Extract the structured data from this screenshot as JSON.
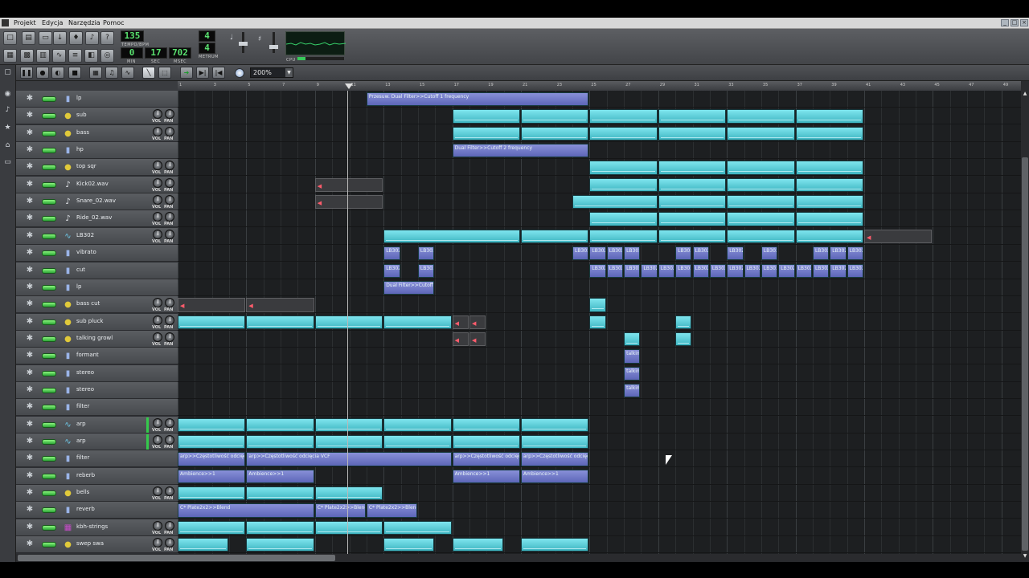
{
  "menu": [
    "Projekt",
    "Edycja",
    "Narzędzia",
    "Pomoc"
  ],
  "transport": {
    "tempo": "135",
    "tempo_label": "TEMPO/BPM",
    "min": "0",
    "sec": "17",
    "msec": "702",
    "min_label": "MIN",
    "sec_label": "SEC",
    "msec_label": "MSEC",
    "meter_num": "4",
    "meter_den": "4",
    "meter_label": "METRUM",
    "cpu_label": "CPU"
  },
  "song_toolbar": {
    "zoom": "200%"
  },
  "knob_labels": {
    "vol": "VOL",
    "pan": "PAN"
  },
  "ruler_ticks": [
    "1",
    "3",
    "5",
    "7",
    "9",
    "11",
    "13",
    "15",
    "17",
    "19",
    "21",
    "23",
    "25",
    "27",
    "29",
    "31",
    "33",
    "35",
    "37",
    "39",
    "41",
    "43",
    "45",
    "47",
    "49"
  ],
  "colors": {
    "pattern": "#5fd0db",
    "automation": "#7a82cf",
    "track_bg": "#505357",
    "mute_led": "#53d44f"
  },
  "timeline": {
    "playhead_bar": 11
  },
  "tracks": [
    {
      "name": "lp",
      "type": "automation",
      "knobs": false,
      "clips": [
        {
          "kind": "auto",
          "start": 12,
          "len": 13,
          "label": "Przesuw. Dual Filter>>Cutoff 1 frequency"
        }
      ]
    },
    {
      "name": "sub",
      "type": "instrument",
      "knobs": true,
      "clips": [
        {
          "kind": "pat",
          "start": 17,
          "len": 4
        },
        {
          "kind": "pat",
          "start": 21,
          "len": 4
        },
        {
          "kind": "pat",
          "start": 25,
          "len": 4
        },
        {
          "kind": "pat",
          "start": 29,
          "len": 4
        },
        {
          "kind": "pat",
          "start": 33,
          "len": 4
        },
        {
          "kind": "pat",
          "start": 37,
          "len": 4
        }
      ]
    },
    {
      "name": "bass",
      "type": "instrument",
      "knobs": true,
      "clips": [
        {
          "kind": "pat",
          "start": 17,
          "len": 4
        },
        {
          "kind": "pat",
          "start": 21,
          "len": 4
        },
        {
          "kind": "pat",
          "start": 25,
          "len": 4
        },
        {
          "kind": "pat",
          "start": 29,
          "len": 4
        },
        {
          "kind": "pat",
          "start": 33,
          "len": 4
        },
        {
          "kind": "pat",
          "start": 37,
          "len": 4
        }
      ]
    },
    {
      "name": "hp",
      "type": "automation",
      "knobs": false,
      "clips": [
        {
          "kind": "auto",
          "start": 17,
          "len": 8,
          "label": "Dual Filter>>Cutoff 2 frequency"
        }
      ]
    },
    {
      "name": "top sqr",
      "type": "instrument",
      "knobs": true,
      "clips": [
        {
          "kind": "pat",
          "start": 25,
          "len": 4
        },
        {
          "kind": "pat",
          "start": 29,
          "len": 4
        },
        {
          "kind": "pat",
          "start": 33,
          "len": 4
        },
        {
          "kind": "pat",
          "start": 37,
          "len": 4
        }
      ]
    },
    {
      "name": "Kick02.wav",
      "type": "sample",
      "knobs": true,
      "clips": [
        {
          "kind": "smp",
          "start": 9,
          "len": 4
        },
        {
          "kind": "pat",
          "start": 25,
          "len": 4
        },
        {
          "kind": "pat",
          "start": 29,
          "len": 4
        },
        {
          "kind": "pat",
          "start": 33,
          "len": 4
        },
        {
          "kind": "pat",
          "start": 37,
          "len": 4
        }
      ]
    },
    {
      "name": "Snare_02.wav",
      "type": "sample",
      "knobs": true,
      "clips": [
        {
          "kind": "smp",
          "start": 9,
          "len": 4
        },
        {
          "kind": "pat",
          "start": 24,
          "len": 5
        },
        {
          "kind": "pat",
          "start": 29,
          "len": 4
        },
        {
          "kind": "pat",
          "start": 33,
          "len": 4
        },
        {
          "kind": "pat",
          "start": 37,
          "len": 4
        }
      ]
    },
    {
      "name": "Ride_02.wav",
      "type": "sample",
      "knobs": true,
      "clips": [
        {
          "kind": "pat",
          "start": 25,
          "len": 4
        },
        {
          "kind": "pat",
          "start": 29,
          "len": 4
        },
        {
          "kind": "pat",
          "start": 33,
          "len": 4
        },
        {
          "kind": "pat",
          "start": 37,
          "len": 4
        }
      ]
    },
    {
      "name": "LB302",
      "type": "synth",
      "knobs": true,
      "clips": [
        {
          "kind": "pat",
          "start": 13,
          "len": 8
        },
        {
          "kind": "pat",
          "start": 21,
          "len": 4
        },
        {
          "kind": "pat",
          "start": 25,
          "len": 4
        },
        {
          "kind": "pat",
          "start": 29,
          "len": 4
        },
        {
          "kind": "pat",
          "start": 33,
          "len": 4
        },
        {
          "kind": "pat",
          "start": 37,
          "len": 4
        },
        {
          "kind": "smp",
          "start": 41,
          "len": 4
        }
      ]
    },
    {
      "name": "vibrato",
      "type": "automation",
      "knobs": false,
      "clips": [
        {
          "kind": "auto",
          "start": 13,
          "len": 1,
          "label": "LB302"
        },
        {
          "kind": "auto",
          "start": 15,
          "len": 1,
          "label": "LB302"
        },
        {
          "kind": "auto",
          "start": 24,
          "len": 1,
          "label": "LB302"
        },
        {
          "kind": "auto",
          "start": 25,
          "len": 1,
          "label": "LB302"
        },
        {
          "kind": "auto",
          "start": 26,
          "len": 1,
          "label": "LB302"
        },
        {
          "kind": "auto",
          "start": 27,
          "len": 1,
          "label": "LB302"
        },
        {
          "kind": "auto",
          "start": 30,
          "len": 1,
          "label": "LB302"
        },
        {
          "kind": "auto",
          "start": 31,
          "len": 1,
          "label": "LB302"
        },
        {
          "kind": "auto",
          "start": 33,
          "len": 1,
          "label": "LB302"
        },
        {
          "kind": "auto",
          "start": 35,
          "len": 1,
          "label": "LB302"
        },
        {
          "kind": "auto",
          "start": 38,
          "len": 1,
          "label": "LB302"
        },
        {
          "kind": "auto",
          "start": 39,
          "len": 1,
          "label": "LB302"
        },
        {
          "kind": "auto",
          "start": 40,
          "len": 1,
          "label": "LB302"
        }
      ]
    },
    {
      "name": "cut",
      "type": "automation",
      "knobs": false,
      "clips": [
        {
          "kind": "auto",
          "start": 13,
          "len": 1,
          "label": "LB302"
        },
        {
          "kind": "auto",
          "start": 15,
          "len": 1,
          "label": "LB302"
        },
        {
          "kind": "auto",
          "start": 25,
          "len": 1,
          "label": "LB302"
        },
        {
          "kind": "auto",
          "start": 26,
          "len": 1,
          "label": "LB302"
        },
        {
          "kind": "auto",
          "start": 27,
          "len": 1,
          "label": "LB302"
        },
        {
          "kind": "auto",
          "start": 28,
          "len": 1,
          "label": "LB302"
        },
        {
          "kind": "auto",
          "start": 29,
          "len": 1,
          "label": "LB302"
        },
        {
          "kind": "auto",
          "start": 30,
          "len": 1,
          "label": "LB302"
        },
        {
          "kind": "auto",
          "start": 31,
          "len": 1,
          "label": "LB302"
        },
        {
          "kind": "auto",
          "start": 32,
          "len": 1,
          "label": "LB302"
        },
        {
          "kind": "auto",
          "start": 33,
          "len": 1,
          "label": "LB302"
        },
        {
          "kind": "auto",
          "start": 34,
          "len": 1,
          "label": "LB302"
        },
        {
          "kind": "auto",
          "start": 35,
          "len": 1,
          "label": "LB302"
        },
        {
          "kind": "auto",
          "start": 36,
          "len": 1,
          "label": "LB302"
        },
        {
          "kind": "auto",
          "start": 37,
          "len": 1,
          "label": "LB302"
        },
        {
          "kind": "auto",
          "start": 38,
          "len": 1,
          "label": "LB302"
        },
        {
          "kind": "auto",
          "start": 39,
          "len": 1,
          "label": "LB302"
        },
        {
          "kind": "auto",
          "start": 40,
          "len": 1,
          "label": "LB302"
        }
      ]
    },
    {
      "name": "lp",
      "type": "automation",
      "knobs": false,
      "clips": [
        {
          "kind": "auto",
          "start": 13,
          "len": 3,
          "label": "Dual Filter>>Cutoff"
        }
      ]
    },
    {
      "name": "bass cut",
      "type": "instrument",
      "knobs": true,
      "clips": [
        {
          "kind": "smp",
          "start": 1,
          "len": 4
        },
        {
          "kind": "smp",
          "start": 5,
          "len": 4
        },
        {
          "kind": "pat",
          "start": 25,
          "len": 1
        }
      ]
    },
    {
      "name": "sub pluck",
      "type": "instrument",
      "knobs": true,
      "clips": [
        {
          "kind": "pat",
          "start": 1,
          "len": 4
        },
        {
          "kind": "pat",
          "start": 5,
          "len": 4
        },
        {
          "kind": "pat",
          "start": 9,
          "len": 4
        },
        {
          "kind": "pat",
          "start": 13,
          "len": 4
        },
        {
          "kind": "smp",
          "start": 17,
          "len": 1
        },
        {
          "kind": "smp",
          "start": 18,
          "len": 1
        },
        {
          "kind": "pat",
          "start": 25,
          "len": 1
        },
        {
          "kind": "pat",
          "start": 30,
          "len": 1
        }
      ]
    },
    {
      "name": "talking growl",
      "type": "instrument",
      "knobs": true,
      "clips": [
        {
          "kind": "smp",
          "start": 17,
          "len": 1
        },
        {
          "kind": "smp",
          "start": 18,
          "len": 1
        },
        {
          "kind": "pat",
          "start": 27,
          "len": 1
        },
        {
          "kind": "pat",
          "start": 30,
          "len": 1
        }
      ]
    },
    {
      "name": "formant",
      "type": "automation",
      "knobs": false,
      "clips": [
        {
          "kind": "auto",
          "start": 27,
          "len": 1,
          "label": "talking"
        }
      ]
    },
    {
      "name": "stereo",
      "type": "automation",
      "knobs": false,
      "clips": [
        {
          "kind": "auto",
          "start": 27,
          "len": 1,
          "label": "talking"
        }
      ]
    },
    {
      "name": "stereo",
      "type": "automation",
      "knobs": false,
      "clips": [
        {
          "kind": "auto",
          "start": 27,
          "len": 1,
          "label": "talking"
        }
      ]
    },
    {
      "name": "filter",
      "type": "automation",
      "knobs": false,
      "clips": []
    },
    {
      "name": "arp",
      "type": "synth",
      "knobs": true,
      "clips": [
        {
          "kind": "pat",
          "start": 1,
          "len": 4
        },
        {
          "kind": "pat",
          "start": 5,
          "len": 4
        },
        {
          "kind": "pat",
          "start": 9,
          "len": 4
        },
        {
          "kind": "pat",
          "start": 13,
          "len": 4
        },
        {
          "kind": "pat",
          "start": 17,
          "len": 4
        },
        {
          "kind": "pat",
          "start": 21,
          "len": 4
        }
      ]
    },
    {
      "name": "arp",
      "type": "synth",
      "knobs": true,
      "clips": [
        {
          "kind": "pat",
          "start": 1,
          "len": 4
        },
        {
          "kind": "pat",
          "start": 5,
          "len": 4
        },
        {
          "kind": "pat",
          "start": 9,
          "len": 4
        },
        {
          "kind": "pat",
          "start": 13,
          "len": 4
        },
        {
          "kind": "pat",
          "start": 17,
          "len": 4
        },
        {
          "kind": "pat",
          "start": 21,
          "len": 4
        }
      ]
    },
    {
      "name": "filter",
      "type": "automation",
      "knobs": false,
      "clips": [
        {
          "kind": "auto",
          "start": 1,
          "len": 4,
          "label": "arp>>Częstotliwość odcięcia VCF"
        },
        {
          "kind": "auto",
          "start": 5,
          "len": 12,
          "label": "arp>>Częstotliwość odcięcia VCF"
        },
        {
          "kind": "auto",
          "start": 17,
          "len": 4,
          "label": "arp>>Częstotliwość odcięcia VCF"
        },
        {
          "kind": "auto",
          "start": 21,
          "len": 4,
          "label": "arp>>Częstotliwość odcięcia VCF"
        }
      ]
    },
    {
      "name": "reberb",
      "type": "automation",
      "knobs": false,
      "clips": [
        {
          "kind": "auto",
          "start": 1,
          "len": 4,
          "label": "Ambience>>1"
        },
        {
          "kind": "auto",
          "start": 5,
          "len": 4,
          "label": "Ambience>>1"
        },
        {
          "kind": "auto",
          "start": 17,
          "len": 4,
          "label": "Ambience>>1"
        },
        {
          "kind": "auto",
          "start": 21,
          "len": 4,
          "label": "Ambience>>1"
        }
      ]
    },
    {
      "name": "bells",
      "type": "instrument",
      "knobs": true,
      "clips": [
        {
          "kind": "pat",
          "start": 1,
          "len": 4
        },
        {
          "kind": "pat",
          "start": 5,
          "len": 4
        },
        {
          "kind": "pat",
          "start": 9,
          "len": 4
        }
      ]
    },
    {
      "name": "reverb",
      "type": "automation",
      "knobs": false,
      "clips": [
        {
          "kind": "auto",
          "start": 1,
          "len": 8,
          "label": "C* Plate2x2>>Blend"
        },
        {
          "kind": "auto",
          "start": 9,
          "len": 3,
          "label": "C* Plate2x2>>Blend"
        },
        {
          "kind": "auto",
          "start": 12,
          "len": 3,
          "label": "C* Plate2x2>>Blend"
        }
      ]
    },
    {
      "name": "kbh-strings",
      "type": "soundfont",
      "knobs": true,
      "clips": [
        {
          "kind": "pat",
          "start": 1,
          "len": 4
        },
        {
          "kind": "pat",
          "start": 5,
          "len": 4
        },
        {
          "kind": "pat",
          "start": 9,
          "len": 4
        },
        {
          "kind": "pat",
          "start": 13,
          "len": 4
        }
      ]
    },
    {
      "name": "swep swa",
      "type": "instrument",
      "knobs": true,
      "clips": [
        {
          "kind": "pat",
          "start": 1,
          "len": 3
        },
        {
          "kind": "pat",
          "start": 5,
          "len": 4
        },
        {
          "kind": "pat",
          "start": 13,
          "len": 3
        },
        {
          "kind": "pat",
          "start": 17,
          "len": 3
        },
        {
          "kind": "pat",
          "start": 21,
          "len": 4
        }
      ]
    }
  ]
}
